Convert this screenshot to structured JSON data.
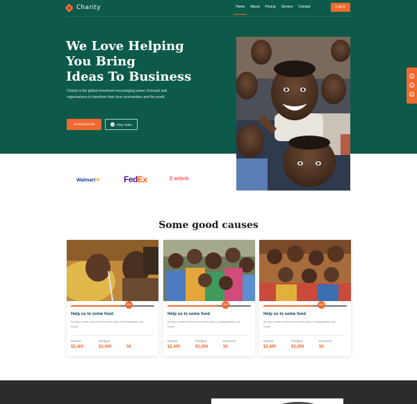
{
  "brand": {
    "name": "Charity"
  },
  "nav": {
    "items": [
      "Home",
      "About",
      "Pricing",
      "Service",
      "Contact"
    ],
    "active": "Home",
    "login_label": "Log In"
  },
  "hero": {
    "title_line1": "We Love Helping",
    "title_line2": "You Bring",
    "title_line3": "Ideas To Business",
    "subtitle": "Charity is the global movement encouraging power of people and organizations to transform their love communities and the world.",
    "download_label": "Download Now",
    "video_label": "Play Video",
    "image": "smiling-children-photo"
  },
  "social": {
    "icons": [
      "facebook-icon",
      "twitter-icon",
      "instagram-icon"
    ],
    "glyphs": [
      "f",
      "t",
      "o"
    ]
  },
  "partners": {
    "walmart": "Walmart",
    "fedex_fed": "Fed",
    "fedex_ex": "Ex",
    "airbnb": "airbnb"
  },
  "causes": {
    "title": "Some good causes",
    "cards": [
      {
        "image": "child-drinking-water-photo",
        "badge": "60%",
        "progress": 0.6,
        "title": "Help us to some food",
        "description": "As flood water recedes from most parts of Bangladesh and tough.",
        "raised_label": "Raised",
        "raised_value": "$2,400",
        "pledged_label": "Pledged",
        "pledged_value": "$2,400",
        "donators_label": "",
        "donators_value": "50"
      },
      {
        "image": "group-of-children-photo",
        "badge": "60%",
        "progress": 0.6,
        "title": "Help us to some food",
        "description": "As flood water recedes from most parts of Bangladesh and tough.",
        "raised_label": "Raised",
        "raised_value": "$2,400",
        "pledged_label": "Pledged",
        "pledged_value": "$2,400",
        "donators_label": "Donators",
        "donators_value": "50"
      },
      {
        "image": "children-in-village-photo",
        "badge": "60%",
        "progress": 0.6,
        "title": "Help us to some food",
        "description": "As flood water recedes from most parts of Bangladesh and tough.",
        "raised_label": "Raised",
        "raised_value": "$2,400",
        "pledged_label": "Pledged",
        "pledged_value": "$2,400",
        "donators_label": "Donators",
        "donators_value": "50"
      }
    ]
  },
  "colors": {
    "primary": "#0d5a4a",
    "accent": "#f0692f",
    "dark": "#2b2c2c"
  }
}
